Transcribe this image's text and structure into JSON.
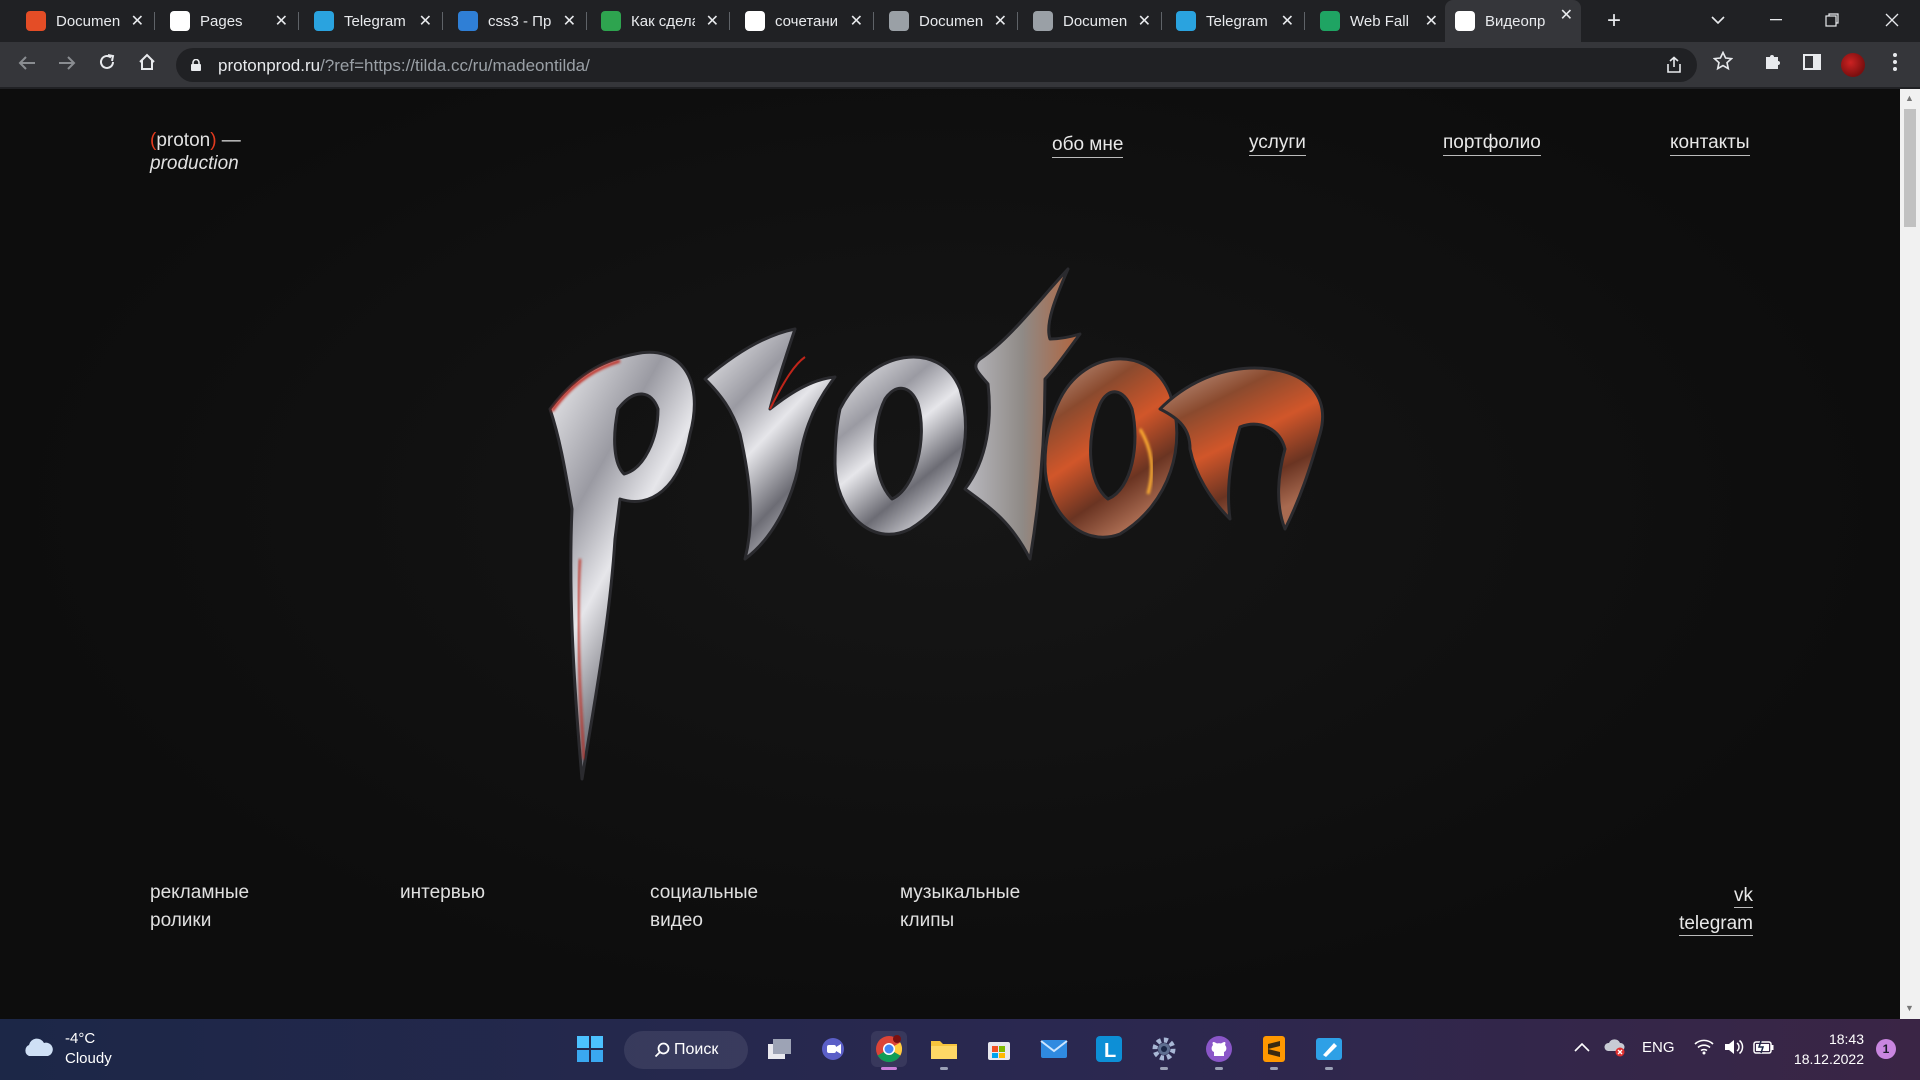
{
  "browser": {
    "tabs": [
      {
        "title": "Document",
        "favicon": "html5-icon",
        "color": "#e44d26"
      },
      {
        "title": "Pages",
        "favicon": "github-icon",
        "color": "#ffffff"
      },
      {
        "title": "Telegram",
        "favicon": "telegram-icon",
        "color": "#2aa3df"
      },
      {
        "title": "css3 - Пр",
        "favicon": "stackoverflow-icon",
        "color": "#2f7fd6"
      },
      {
        "title": "Как сдела",
        "favicon": "leaf-icon",
        "color": "#2ea44f"
      },
      {
        "title": "сочетани",
        "favicon": "google-icon",
        "color": "#ffffff"
      },
      {
        "title": "Documen",
        "favicon": "globe-icon",
        "color": "#9aa0a6"
      },
      {
        "title": "Documen",
        "favicon": "globe-icon",
        "color": "#9aa0a6"
      },
      {
        "title": "Telegram",
        "favicon": "telegram-icon",
        "color": "#2aa3df"
      },
      {
        "title": "Web Fall",
        "favicon": "sheets-icon",
        "color": "#1fa463"
      },
      {
        "title": "Видеопр",
        "favicon": "tilda-icon",
        "color": "#ffffff",
        "active": true
      }
    ],
    "close_glyph": "✕",
    "new_tab_glyph": "+",
    "url_host": "protonprod.ru",
    "url_rest": "/?ref=https://tilda.cc/ru/madeontilda/"
  },
  "site": {
    "brand_line1_accent_open": "(",
    "brand_line1_text": "proton",
    "brand_line1_accent_close": ")",
    "brand_line1_dash": " —",
    "brand_line2": "production",
    "logo_text": "proton",
    "nav": [
      "обо мне",
      "услуги",
      "портфолио",
      "контакты"
    ],
    "categories": [
      {
        "line1": "рекламные",
        "line2": "ролики"
      },
      {
        "line1": "интервью",
        "line2": ""
      },
      {
        "line1": "социальные",
        "line2": "видео"
      },
      {
        "line1": "музыкальные",
        "line2": "клипы"
      }
    ],
    "social": [
      "vk",
      "telegram"
    ],
    "accent_color": "#e23a1e"
  },
  "taskbar": {
    "weather_temp": "-4°C",
    "weather_desc": "Cloudy",
    "search_label": "Поиск",
    "lang": "ENG",
    "time": "18:43",
    "date": "18.12.2022",
    "notifications": "1"
  }
}
